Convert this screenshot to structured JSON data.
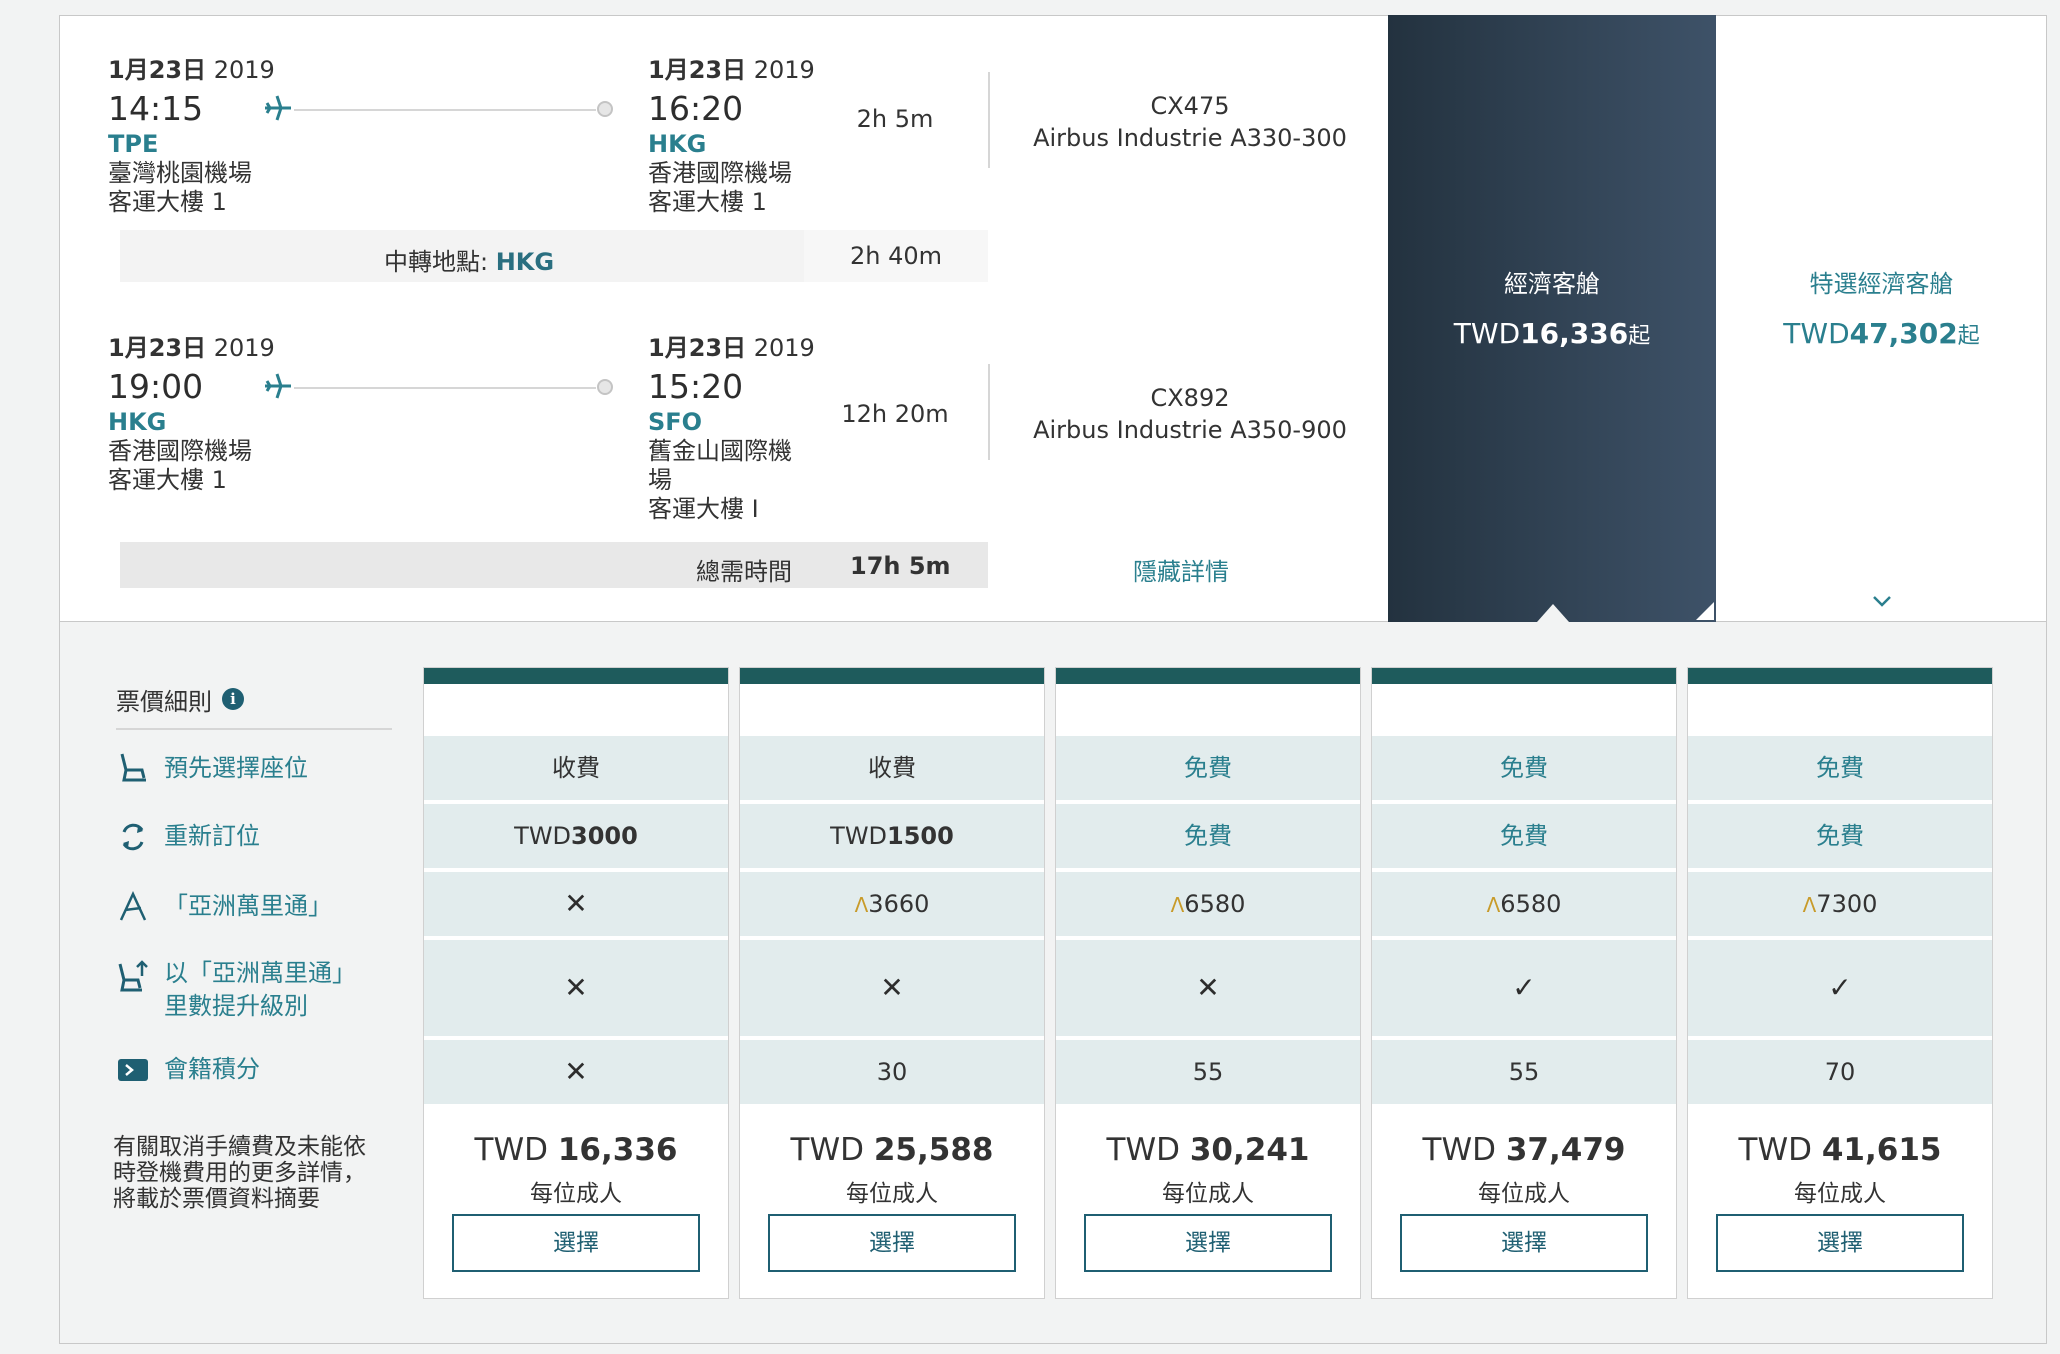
{
  "segments": [
    {
      "depart": {
        "date_md": "1月23日",
        "date_y": "2019",
        "time": "14:15",
        "code": "TPE",
        "airport_l1": "臺灣桃園機場",
        "airport_l2": "客運大樓 1"
      },
      "arrive": {
        "date_md": "1月23日",
        "date_y": "2019",
        "time": "16:20",
        "code": "HKG",
        "airport_l1": "香港國際機場",
        "airport_l2": "客運大樓 1"
      },
      "duration": "2h 5m",
      "flight_no": "CX475",
      "aircraft": "Airbus Industrie A330-300"
    },
    {
      "depart": {
        "date_md": "1月23日",
        "date_y": "2019",
        "time": "19:00",
        "code": "HKG",
        "airport_l1": "香港國際機場",
        "airport_l2": "客運大樓 1"
      },
      "arrive": {
        "date_md": "1月23日",
        "date_y": "2019",
        "time": "15:20",
        "code": "SFO",
        "airport_l1": "舊金山國際機",
        "airport_l1b": "場",
        "airport_l2": "客運大樓 I"
      },
      "duration": "12h 20m",
      "flight_no": "CX892",
      "aircraft": "Airbus Industrie A350-900"
    }
  ],
  "transfer": {
    "label": "中轉地點: ",
    "code": "HKG",
    "duration": "2h 40m"
  },
  "total": {
    "label": "總需時間",
    "value": "17h 5m"
  },
  "hide_details": "隱藏詳情",
  "cabins": {
    "economy": {
      "name": "經濟客艙",
      "currency": "TWD",
      "amount": "16,336",
      "suffix": "起"
    },
    "premium": {
      "name": "特選經濟客艙",
      "currency": "TWD",
      "amount": "47,302",
      "suffix": "起"
    }
  },
  "fare_rules": {
    "title": "票價細則",
    "items": [
      {
        "label": "預先選擇座位",
        "icon": "seat-icon"
      },
      {
        "label": "重新訂位",
        "icon": "rebook-icon"
      },
      {
        "label": "「亞洲萬里通」",
        "icon": "asia-miles-icon"
      },
      {
        "label_l1": "以「亞洲萬里通」",
        "label_l2": "里數提升級別",
        "icon": "upgrade-icon"
      },
      {
        "label": "會籍積分",
        "icon": "club-points-icon"
      }
    ],
    "note_l1": "有關取消手續費及未能依",
    "note_l2": "時登機費用的更多詳情，",
    "note_l3": "將載於票價資料摘要"
  },
  "fares": [
    {
      "seat": "收費",
      "rebook_prefix": "TWD",
      "rebook_amt": "3000",
      "miles": "",
      "upgrade": "✕",
      "club": "✕",
      "price_cur": "TWD ",
      "price": "16,336",
      "per": "每位成人",
      "btn": "選擇"
    },
    {
      "seat": "收費",
      "rebook_prefix": "TWD",
      "rebook_amt": "1500",
      "miles": "3660",
      "upgrade": "✕",
      "club": "30",
      "price_cur": "TWD ",
      "price": "25,588",
      "per": "每位成人",
      "btn": "選擇"
    },
    {
      "seat": "免費",
      "rebook_prefix": "",
      "rebook_amt": "免費",
      "miles": "6580",
      "upgrade": "✕",
      "club": "55",
      "price_cur": "TWD ",
      "price": "30,241",
      "per": "每位成人",
      "btn": "選擇"
    },
    {
      "seat": "免費",
      "rebook_prefix": "",
      "rebook_amt": "免費",
      "miles": "6580",
      "upgrade": "✓",
      "club": "55",
      "price_cur": "TWD ",
      "price": "37,479",
      "per": "每位成人",
      "btn": "選擇"
    },
    {
      "seat": "免費",
      "rebook_prefix": "",
      "rebook_amt": "免費",
      "miles": "7300",
      "upgrade": "✓",
      "club": "70",
      "price_cur": "TWD ",
      "price": "41,615",
      "per": "每位成人",
      "btn": "選擇"
    }
  ],
  "colors": {
    "accent": "#2a7f8e",
    "dark_teal": "#1e5b5c",
    "cell_bg": "#e2eced",
    "eco_dark": "#23323f"
  }
}
